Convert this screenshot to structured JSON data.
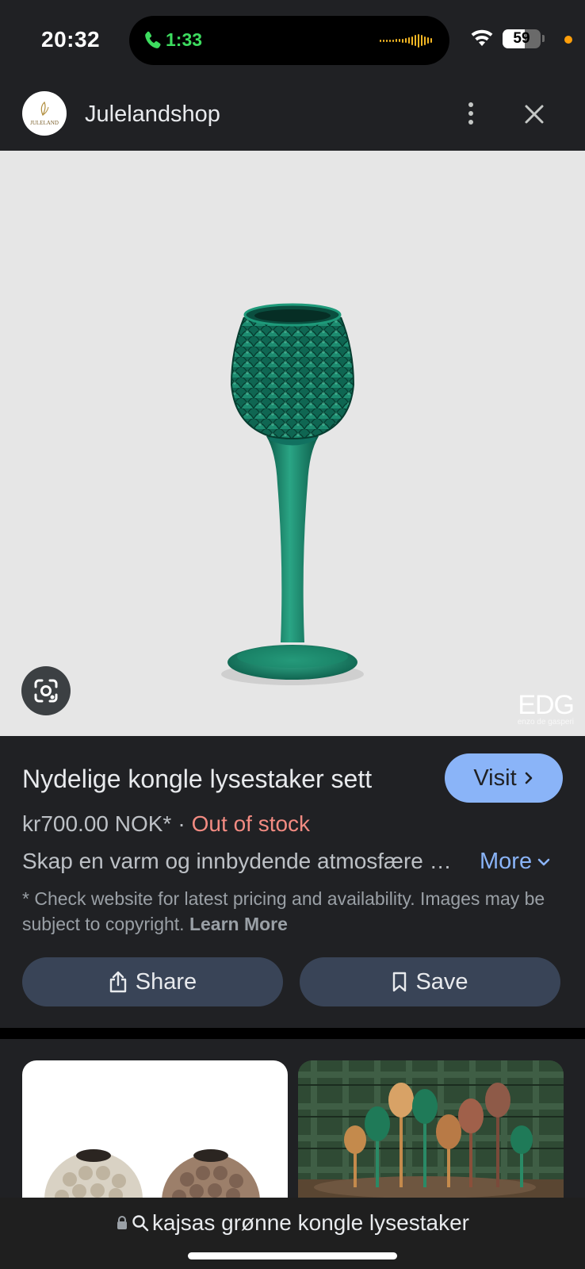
{
  "status_bar": {
    "time": "20:32",
    "call_timer": "1:33",
    "battery_level": "59",
    "battery_fraction": 0.59
  },
  "header": {
    "site_name": "Julelandshop",
    "logo_text": "JULELAND"
  },
  "image": {
    "watermark": "EDG",
    "watermark_sub": "enzo de gasperi"
  },
  "product": {
    "title": "Nydelige kongle lysestaker sett",
    "visit_label": "Visit",
    "price": "kr700.00 NOK*",
    "separator": "·",
    "stock_status": "Out of stock",
    "description": "Skap en varm og innbydende atmosfære med disse nydelige kongle lysestakerne",
    "more_label": "More",
    "disclaimer": "* Check website for latest pricing and availability. Images may be subject to copyright.",
    "learn_more": "Learn More",
    "share_label": "Share",
    "save_label": "Save"
  },
  "bottom_bar": {
    "url": "kajsas grønne kongle lysestaker"
  },
  "colors": {
    "background": "#202124",
    "accent": "#8ab4f8",
    "out_of_stock": "#f28b82",
    "action_button": "#394457",
    "glass_green": "#16806a"
  }
}
